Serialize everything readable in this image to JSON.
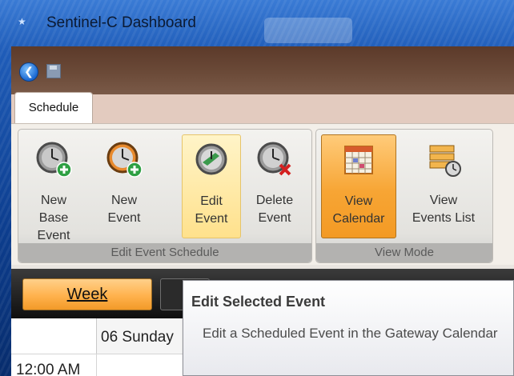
{
  "window": {
    "title": "Sentinel-C Dashboard"
  },
  "ribbon": {
    "tab": "Schedule",
    "groups": [
      {
        "label": "Edit Event Schedule",
        "buttons": [
          {
            "label": "New\nBase Event",
            "icon": "clock-add-icon"
          },
          {
            "label": "New\nEvent",
            "icon": "clock-add-orange-icon"
          },
          {
            "label": "Edit\nEvent",
            "icon": "clock-edit-icon",
            "state": "hover"
          },
          {
            "label": "Delete\nEvent",
            "icon": "clock-delete-icon"
          }
        ]
      },
      {
        "label": "View Mode",
        "buttons": [
          {
            "label": "View\nCalendar",
            "icon": "calendar-icon",
            "state": "pressed"
          },
          {
            "label": "View\nEvents List",
            "icon": "events-list-icon"
          }
        ]
      }
    ]
  },
  "calendar": {
    "view_button": "Week",
    "day_header": "06 Sunday",
    "time_label": "12:00 AM"
  },
  "tooltip": {
    "title": "Edit Selected Event",
    "text": "Edit a Scheduled Event in the Gateway Calendar"
  },
  "colors": {
    "accent_orange": "#f7a534",
    "hover_yellow": "#ffe18c",
    "frame_blue": "#1f5cb8"
  }
}
